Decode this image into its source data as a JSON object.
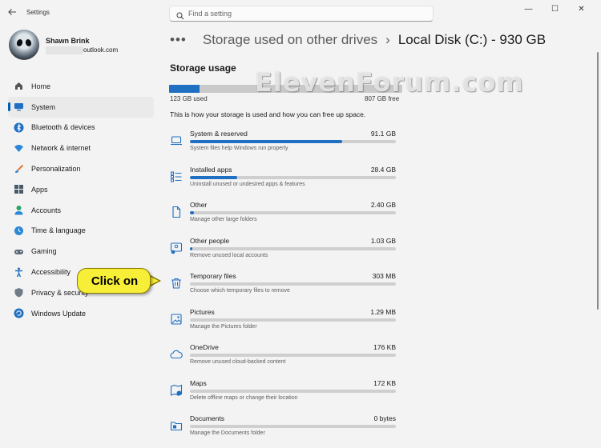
{
  "window": {
    "title": "Settings",
    "back_icon": "back-arrow-icon",
    "controls": {
      "minimize": "—",
      "maximize": "☐",
      "close": "✕"
    }
  },
  "search": {
    "placeholder": "Find a setting",
    "value": ""
  },
  "profile": {
    "name": "Shawn Brink",
    "email_suffix": "outlook.com"
  },
  "sidebar": {
    "items": [
      {
        "label": "Home",
        "icon": "home-icon",
        "color": "#555555",
        "active": false
      },
      {
        "label": "System",
        "icon": "system-icon",
        "color": "#1f6fc3",
        "active": true
      },
      {
        "label": "Bluetooth & devices",
        "icon": "bluetooth-icon",
        "color": "#1f6fc3",
        "active": false
      },
      {
        "label": "Network & internet",
        "icon": "network-icon",
        "color": "#2b88d8",
        "active": false
      },
      {
        "label": "Personalization",
        "icon": "brush-icon",
        "color": "#e07a3a",
        "active": false
      },
      {
        "label": "Apps",
        "icon": "apps-icon",
        "color": "#4a5a6a",
        "active": false
      },
      {
        "label": "Accounts",
        "icon": "accounts-icon",
        "color": "#2aa36b",
        "active": false
      },
      {
        "label": "Time & language",
        "icon": "time-language-icon",
        "color": "#2b88d8",
        "active": false
      },
      {
        "label": "Gaming",
        "icon": "gaming-icon",
        "color": "#5a6a78",
        "active": false
      },
      {
        "label": "Accessibility",
        "icon": "accessibility-icon",
        "color": "#1f6fc3",
        "active": false
      },
      {
        "label": "Privacy & security",
        "icon": "shield-icon",
        "color": "#6f7b86",
        "active": false
      },
      {
        "label": "Windows Update",
        "icon": "windows-update-icon",
        "color": "#1f6fc3",
        "active": false
      }
    ]
  },
  "breadcrumb": {
    "more": "•••",
    "parent": "Storage used on other drives",
    "separator": "›",
    "current": "Local Disk (C:) - 930 GB"
  },
  "storage": {
    "title": "Storage usage",
    "used_label": "123 GB used",
    "free_label": "807 GB free",
    "used_fraction": 0.132,
    "intro": "This is how your storage is used and how you can free up space."
  },
  "categories": [
    {
      "name": "System & reserved",
      "size": "91.1 GB",
      "desc": "System files help Windows run properly",
      "fraction": 0.74,
      "icon": "laptop-icon"
    },
    {
      "name": "Installed apps",
      "size": "28.4 GB",
      "desc": "Uninstall unused or undesired apps & features",
      "fraction": 0.23,
      "icon": "apps-list-icon"
    },
    {
      "name": "Other",
      "size": "2.40 GB",
      "desc": "Manage other large folders",
      "fraction": 0.02,
      "icon": "file-icon"
    },
    {
      "name": "Other people",
      "size": "1.03 GB",
      "desc": "Remove unused local accounts",
      "fraction": 0.01,
      "icon": "people-icon"
    },
    {
      "name": "Temporary files",
      "size": "303 MB",
      "desc": "Choose which temporary files to remove",
      "fraction": 0.0,
      "icon": "trash-icon"
    },
    {
      "name": "Pictures",
      "size": "1.29 MB",
      "desc": "Manage the Pictures folder",
      "fraction": 0.0,
      "icon": "pictures-icon"
    },
    {
      "name": "OneDrive",
      "size": "176 KB",
      "desc": "Remove unused cloud-backed content",
      "fraction": 0.0,
      "icon": "cloud-icon"
    },
    {
      "name": "Maps",
      "size": "172 KB",
      "desc": "Delete offline maps or change their location",
      "fraction": 0.0,
      "icon": "map-icon"
    },
    {
      "name": "Documents",
      "size": "0 bytes",
      "desc": "Manage the Documents folder",
      "fraction": 0.0,
      "icon": "documents-icon"
    }
  ],
  "callout": {
    "text": "Click on"
  },
  "watermark": {
    "text": "ElevenForum.com"
  },
  "colors": {
    "accent": "#1f6fc3",
    "track": "#cfcfcf",
    "callout": "#f7ee38"
  }
}
